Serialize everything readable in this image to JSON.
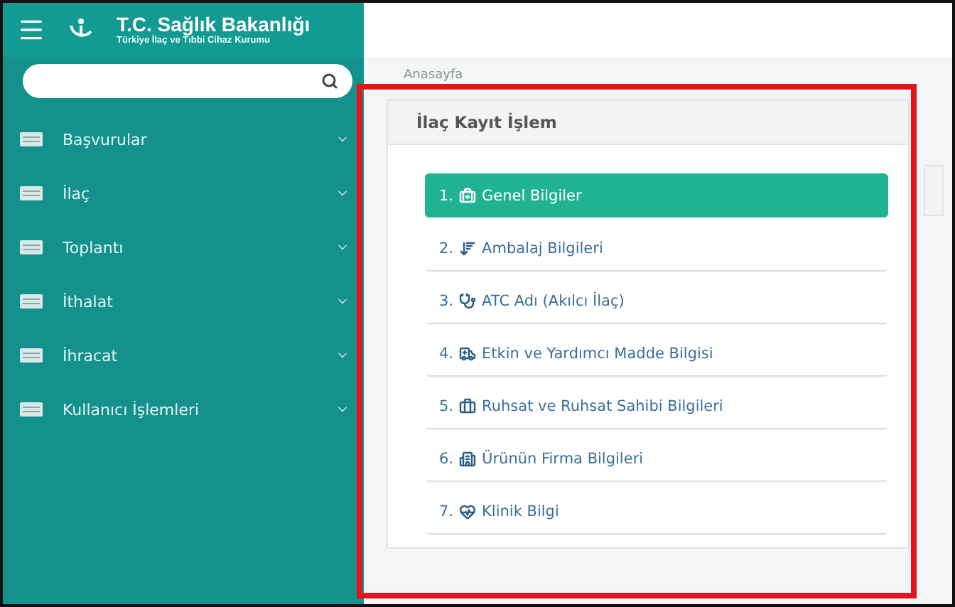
{
  "header": {
    "title": "T.C. Sağlık Bakanlığı",
    "subtitle": "Türkiye İlaç ve Tıbbi Cihaz Kurumu"
  },
  "sidebar": {
    "items": [
      {
        "label": "Başvurular",
        "expanded": false
      },
      {
        "label": "İlaç",
        "expanded": false
      },
      {
        "label": "Toplantı",
        "expanded": false
      },
      {
        "label": "İthalat",
        "expanded": false
      },
      {
        "label": "İhracat",
        "expanded": false
      },
      {
        "label": "Kullanıcı İşlemleri",
        "expanded": false
      }
    ]
  },
  "breadcrumb": "Anasayfa",
  "panel": {
    "title": "İlaç Kayıt İşlem",
    "steps": [
      {
        "number": "1.",
        "label": "Genel Bilgiler",
        "selected": true
      },
      {
        "number": "2.",
        "label": "Ambalaj Bilgileri",
        "selected": false
      },
      {
        "number": "3.",
        "label": "ATC Adı (Akılcı İlaç)",
        "selected": false
      },
      {
        "number": "4.",
        "label": "Etkin ve Yardımcı Madde Bilgisi",
        "selected": false
      },
      {
        "number": "5.",
        "label": "Ruhsat ve Ruhsat Sahibi Bilgileri",
        "selected": false
      },
      {
        "number": "6.",
        "label": "Ürünün Firma Bilgileri",
        "selected": false
      },
      {
        "number": "7.",
        "label": "Klinik Bilgi",
        "selected": false
      }
    ]
  }
}
